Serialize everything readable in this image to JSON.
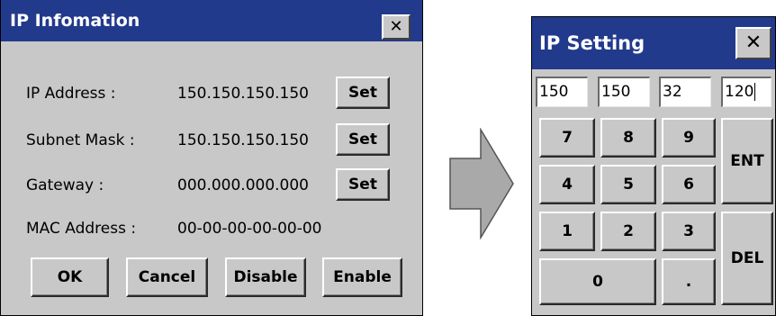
{
  "left_dialog": {
    "title": "IP Infomation",
    "close_glyph": "✕",
    "rows": [
      {
        "label": "IP Address :",
        "value": "150.150.150.150",
        "button": "Set"
      },
      {
        "label": "Subnet Mask :",
        "value": "150.150.150.150",
        "button": "Set"
      },
      {
        "label": "Gateway :",
        "value": "000.000.000.000",
        "button": "Set"
      }
    ],
    "mac": {
      "label": "MAC Address :",
      "value": "00-00-00-00-00-00"
    },
    "buttons": {
      "ok": "OK",
      "cancel": "Cancel",
      "disable": "Disable",
      "enable": "Enable"
    }
  },
  "arrow": {
    "icon": "right-arrow-icon",
    "fill": "#a9a9a9"
  },
  "right_dialog": {
    "title": "IP Setting",
    "close_glyph": "✕",
    "fields": [
      "150",
      "150",
      "32",
      "120"
    ],
    "keys": {
      "k7": "7",
      "k8": "8",
      "k9": "9",
      "k4": "4",
      "k5": "5",
      "k6": "6",
      "k1": "1",
      "k2": "2",
      "k3": "3",
      "k0": "0",
      "dot": ".",
      "ent": "ENT",
      "del": "DEL"
    }
  },
  "colors": {
    "titlebar": "#223a8c",
    "window_bg": "#c8c8c8"
  }
}
